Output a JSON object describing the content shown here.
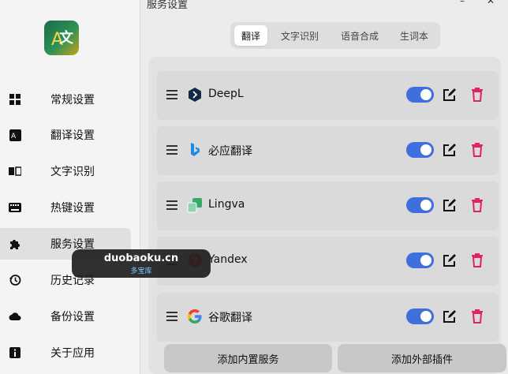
{
  "window": {
    "title": "服务设置",
    "minimize": "–",
    "close": "✕"
  },
  "sidebar": {
    "items": [
      {
        "label": "常规设置",
        "icon": "grid-icon",
        "active": false
      },
      {
        "label": "翻译设置",
        "icon": "translate-icon",
        "active": false
      },
      {
        "label": "文字识别",
        "icon": "ocr-icon",
        "active": false
      },
      {
        "label": "热键设置",
        "icon": "keyboard-icon",
        "active": false
      },
      {
        "label": "服务设置",
        "icon": "puzzle-icon",
        "active": true
      },
      {
        "label": "历史记录",
        "icon": "history-icon",
        "active": false
      },
      {
        "label": "备份设置",
        "icon": "cloud-icon",
        "active": false
      },
      {
        "label": "关于应用",
        "icon": "info-icon",
        "active": false
      }
    ]
  },
  "tabs": [
    {
      "label": "翻译",
      "active": true
    },
    {
      "label": "文字识别",
      "active": false
    },
    {
      "label": "语音合成",
      "active": false
    },
    {
      "label": "生词本",
      "active": false
    }
  ],
  "services": [
    {
      "name": "DeepL",
      "icon": "deepl-icon",
      "enabled": true
    },
    {
      "name": "必应翻译",
      "icon": "bing-icon",
      "enabled": true
    },
    {
      "name": "Lingva",
      "icon": "lingva-icon",
      "enabled": true
    },
    {
      "name": "Yandex",
      "icon": "yandex-icon",
      "enabled": true
    },
    {
      "name": "谷歌翻译",
      "icon": "google-icon",
      "enabled": true
    }
  ],
  "buttons": {
    "add_builtin": "添加内置服务",
    "add_plugin": "添加外部插件"
  },
  "watermark": {
    "main": "duobaoku.cn",
    "sub": "多宝库"
  },
  "colors": {
    "toggle_on": "#3e6fdc",
    "delete": "#e0245e",
    "accent_green": "#2e9156"
  }
}
